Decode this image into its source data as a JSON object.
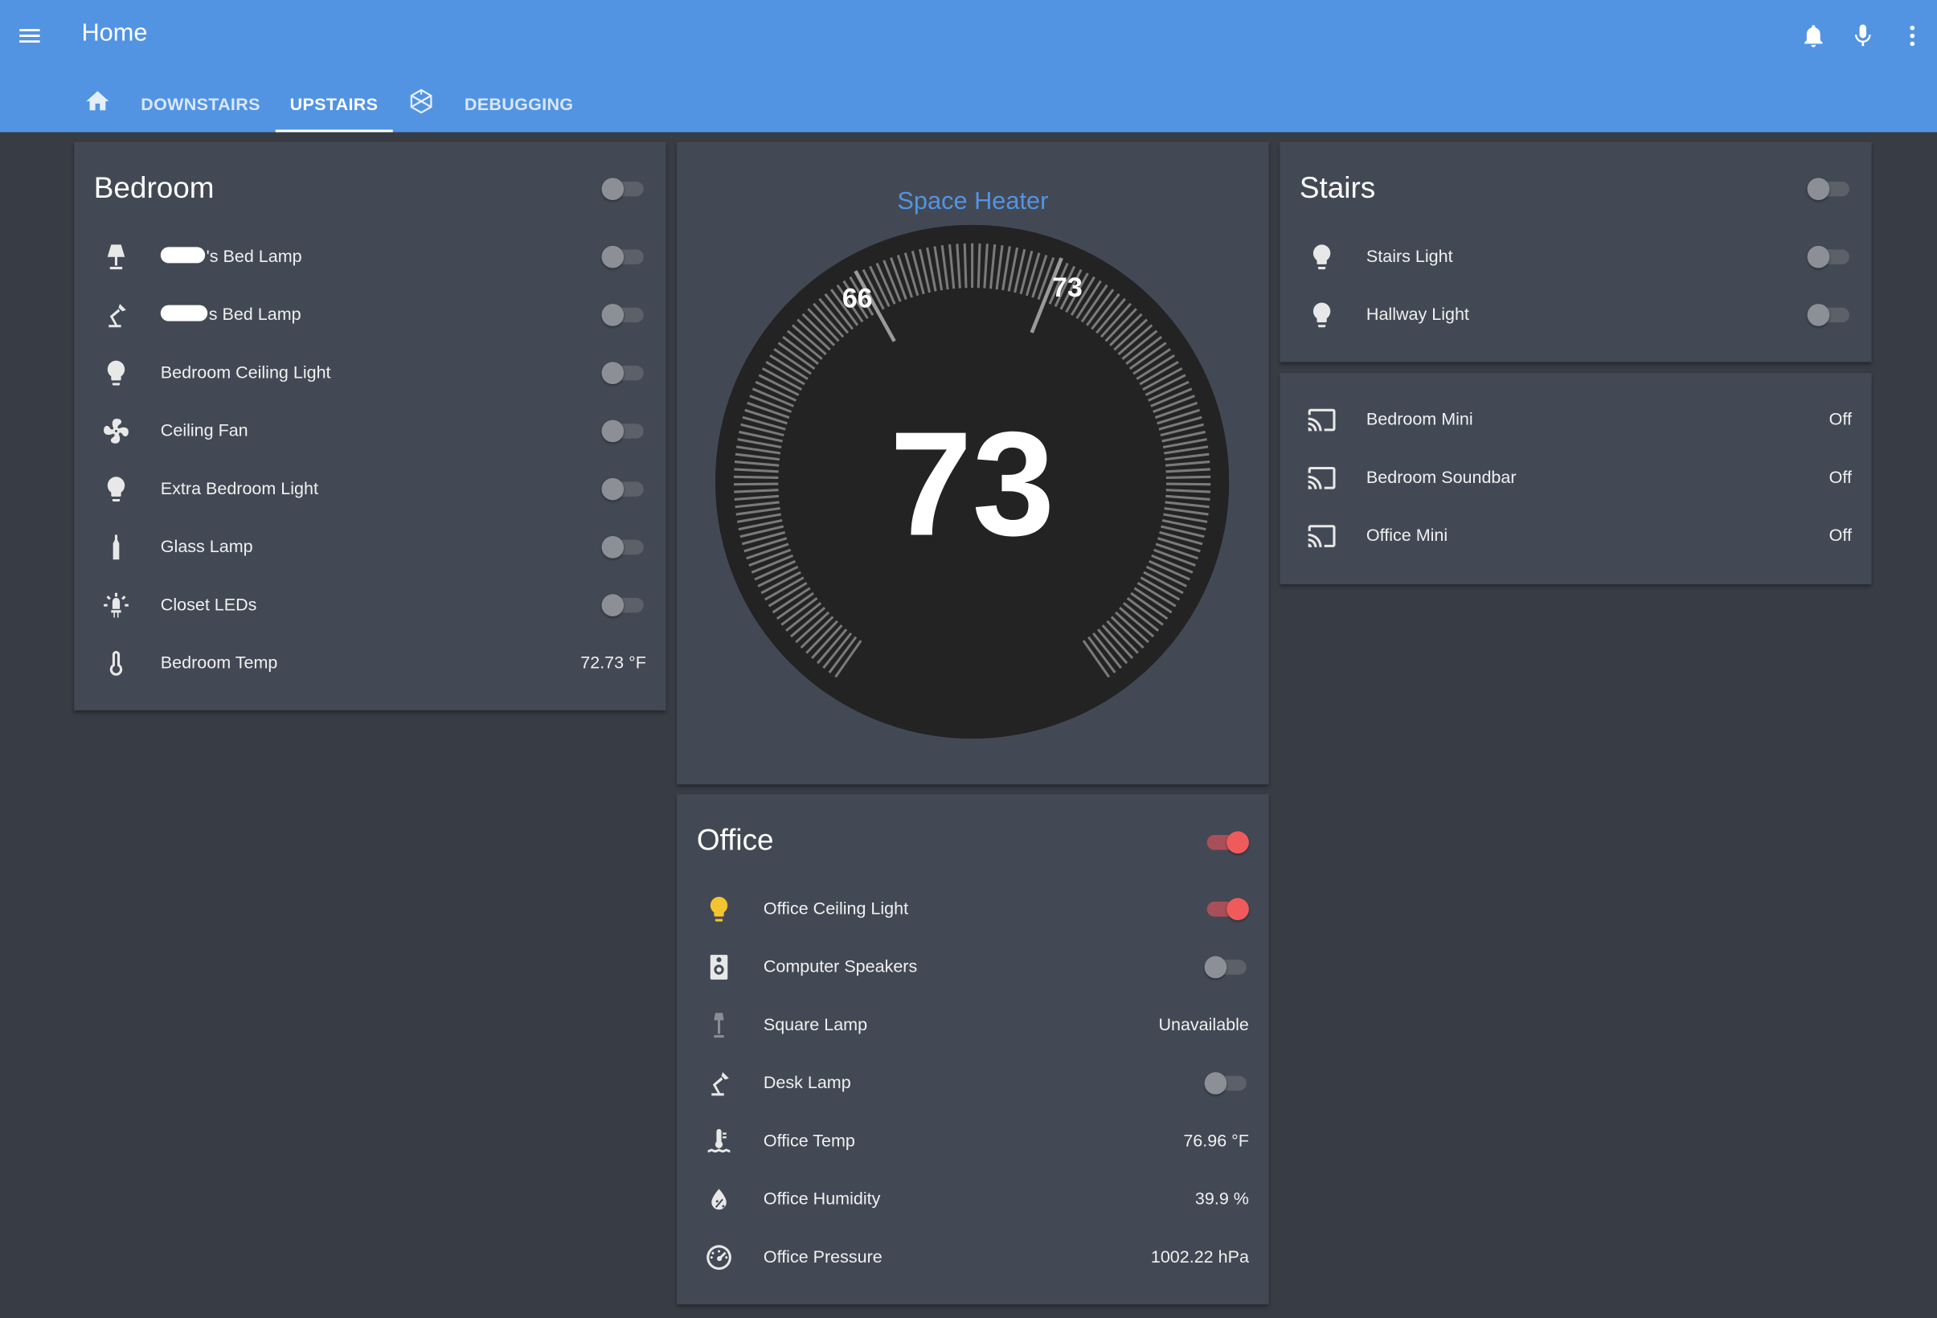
{
  "header": {
    "title": "Home",
    "icons": [
      "menu-icon",
      "bell-icon",
      "microphone-icon",
      "more-vert-icon"
    ]
  },
  "tabs": [
    {
      "label": "",
      "icon": "home-icon"
    },
    {
      "label": "DOWNSTAIRS"
    },
    {
      "label": "UPSTAIRS",
      "active": true
    },
    {
      "label": "",
      "icon": "hass-graph-icon"
    },
    {
      "label": "DEBUGGING"
    }
  ],
  "bedroom": {
    "title": "Bedroom",
    "group_on": false,
    "items": [
      {
        "label": "'s Bed Lamp",
        "icon": "lamp-icon",
        "state": "off"
      },
      {
        "label": "s Bed Lamp",
        "icon": "desk-lamp-icon",
        "state": "off"
      },
      {
        "label": "Bedroom Ceiling Light",
        "icon": "lightbulb-icon",
        "state": "off"
      },
      {
        "label": "Ceiling Fan",
        "icon": "fan-icon",
        "state": "off"
      },
      {
        "label": "Extra Bedroom Light",
        "icon": "lightbulb-icon",
        "state": "off"
      },
      {
        "label": "Glass Lamp",
        "icon": "bottle-icon",
        "state": "off"
      },
      {
        "label": "Closet LEDs",
        "icon": "led-icon",
        "state": "off"
      },
      {
        "label": "Bedroom Temp",
        "icon": "thermometer-icon",
        "value": "72.73 °F"
      }
    ]
  },
  "thermostat": {
    "title": "Space Heater",
    "current": "73",
    "low_mark": "66",
    "high_mark": "73",
    "low_value": 66,
    "high_value": 73
  },
  "office": {
    "title": "Office",
    "group_on": true,
    "items": [
      {
        "label": "Office Ceiling Light",
        "icon": "lightbulb-on-icon",
        "state": "on"
      },
      {
        "label": "Computer Speakers",
        "icon": "speaker-icon",
        "state": "off"
      },
      {
        "label": "Square Lamp",
        "icon": "floor-lamp-icon",
        "value": "Unavailable"
      },
      {
        "label": "Desk Lamp",
        "icon": "desk-lamp-icon",
        "state": "off"
      },
      {
        "label": "Office Temp",
        "icon": "thermometer-water-icon",
        "value": "76.96 °F"
      },
      {
        "label": "Office Humidity",
        "icon": "water-percent-icon",
        "value": "39.9 %"
      },
      {
        "label": "Office Pressure",
        "icon": "gauge-icon",
        "value": "1002.22 hPa"
      }
    ]
  },
  "stairs": {
    "title": "Stairs",
    "group_on": false,
    "items": [
      {
        "label": "Stairs Light",
        "icon": "lightbulb-icon",
        "state": "off"
      },
      {
        "label": "Hallway Light",
        "icon": "lightbulb-icon",
        "state": "off"
      }
    ]
  },
  "media": {
    "items": [
      {
        "label": "Bedroom Mini",
        "icon": "cast-icon",
        "value": "Off"
      },
      {
        "label": "Bedroom Soundbar",
        "icon": "cast-icon",
        "value": "Off"
      },
      {
        "label": "Office Mini",
        "icon": "cast-icon",
        "value": "Off"
      }
    ]
  },
  "colors": {
    "header": "#5294e2",
    "background": "#383c45",
    "card": "#434954",
    "toggle_on": "#ef5b5b",
    "bulb_on": "#f4c430",
    "accent_title": "#5294e2"
  }
}
